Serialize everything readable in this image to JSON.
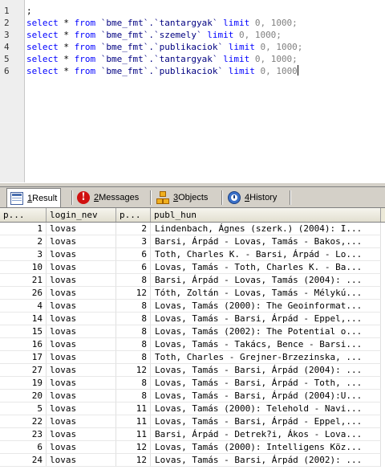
{
  "editor": {
    "line_numbers": [
      "1",
      "2",
      "3",
      "4",
      "5",
      "6"
    ],
    "lines": [
      {
        "text": ";"
      },
      {
        "kw1": "select",
        "star": " * ",
        "kw2": "from",
        "tbl": " `bme_fmt`.`tantargyak` ",
        "kw3": "limit",
        "nums": " 0, 1000;"
      },
      {
        "kw1": "select",
        "star": " * ",
        "kw2": "from",
        "tbl": " `bme_fmt`.`szemely` ",
        "kw3": "limit",
        "nums": " 0, 1000;"
      },
      {
        "kw1": "select",
        "star": " * ",
        "kw2": "from",
        "tbl": " `bme_fmt`.`publikaciok` ",
        "kw3": "limit",
        "nums": " 0, 1000;"
      },
      {
        "kw1": "select",
        "star": " * ",
        "kw2": "from",
        "tbl": " `bme_fmt`.`tantargyak` ",
        "kw3": "limit",
        "nums": " 0, 1000;"
      },
      {
        "kw1": "select",
        "star": " * ",
        "kw2": "from",
        "tbl": " `bme_fmt`.`publikaciok` ",
        "kw3": "limit",
        "nums": " 0, 1000"
      }
    ]
  },
  "tabs": [
    {
      "key": "1",
      "label": " Result",
      "icon": "result-grid-icon"
    },
    {
      "key": "2",
      "label": " Messages",
      "icon": "messages-error-icon"
    },
    {
      "key": "3",
      "label": " Objects",
      "icon": "objects-icon"
    },
    {
      "key": "4",
      "label": " History",
      "icon": "history-icon"
    }
  ],
  "grid": {
    "columns": [
      "p...",
      "login_nev",
      "p...",
      "publ_hun"
    ],
    "rows": [
      [
        "1",
        "lovas",
        "2",
        "Lindenbach, Ágnes (szerk.) (2004): I..."
      ],
      [
        "2",
        "lovas",
        "3",
        "Barsi, Árpád - Lovas, Tamás - Bakos,..."
      ],
      [
        "3",
        "lovas",
        "6",
        "Toth, Charles K. - Barsi, Árpád - Lo..."
      ],
      [
        "10",
        "lovas",
        "6",
        "Lovas, Tamás - Toth, Charles K. - Ba..."
      ],
      [
        "21",
        "lovas",
        "8",
        "Barsi, Árpád - Lovas, Tamás (2004): ..."
      ],
      [
        "26",
        "lovas",
        "12",
        "Tóth, Zoltán - Lovas, Tamás - Mélykú..."
      ],
      [
        "4",
        "lovas",
        "8",
        "Lovas, Tamás (2000): The Geoinformat..."
      ],
      [
        "14",
        "lovas",
        "8",
        "Lovas, Tamás - Barsi, Árpád - Eppel,..."
      ],
      [
        "15",
        "lovas",
        "8",
        "Lovas, Tamás (2002): The Potential o..."
      ],
      [
        "16",
        "lovas",
        "8",
        "Lovas, Tamás - Takács, Bence - Barsi..."
      ],
      [
        "17",
        "lovas",
        "8",
        "Toth, Charles - Grejner-Brzezinska, ..."
      ],
      [
        "27",
        "lovas",
        "12",
        "Lovas, Tamás - Barsi, Árpád (2004): ..."
      ],
      [
        "19",
        "lovas",
        "8",
        "Lovas, Tamás - Barsi, Árpád - Toth, ..."
      ],
      [
        "20",
        "lovas",
        "8",
        "Lovas, Tamás - Barsi, Árpád (2004):U..."
      ],
      [
        "5",
        "lovas",
        "11",
        "Lovas, Tamás (2000): Telehold - Navi..."
      ],
      [
        "22",
        "lovas",
        "11",
        "Lovas, Tamás - Barsi, Árpád - Eppel,..."
      ],
      [
        "23",
        "lovas",
        "11",
        "Barsi, Árpád - Detrek?i, Ákos - Lova..."
      ],
      [
        "6",
        "lovas",
        "12",
        "Lovas, Tamás (2000): Intelligens Köz..."
      ],
      [
        "24",
        "lovas",
        "12",
        "Lovas, Tamás - Barsi, Árpád (2002): ..."
      ]
    ]
  }
}
